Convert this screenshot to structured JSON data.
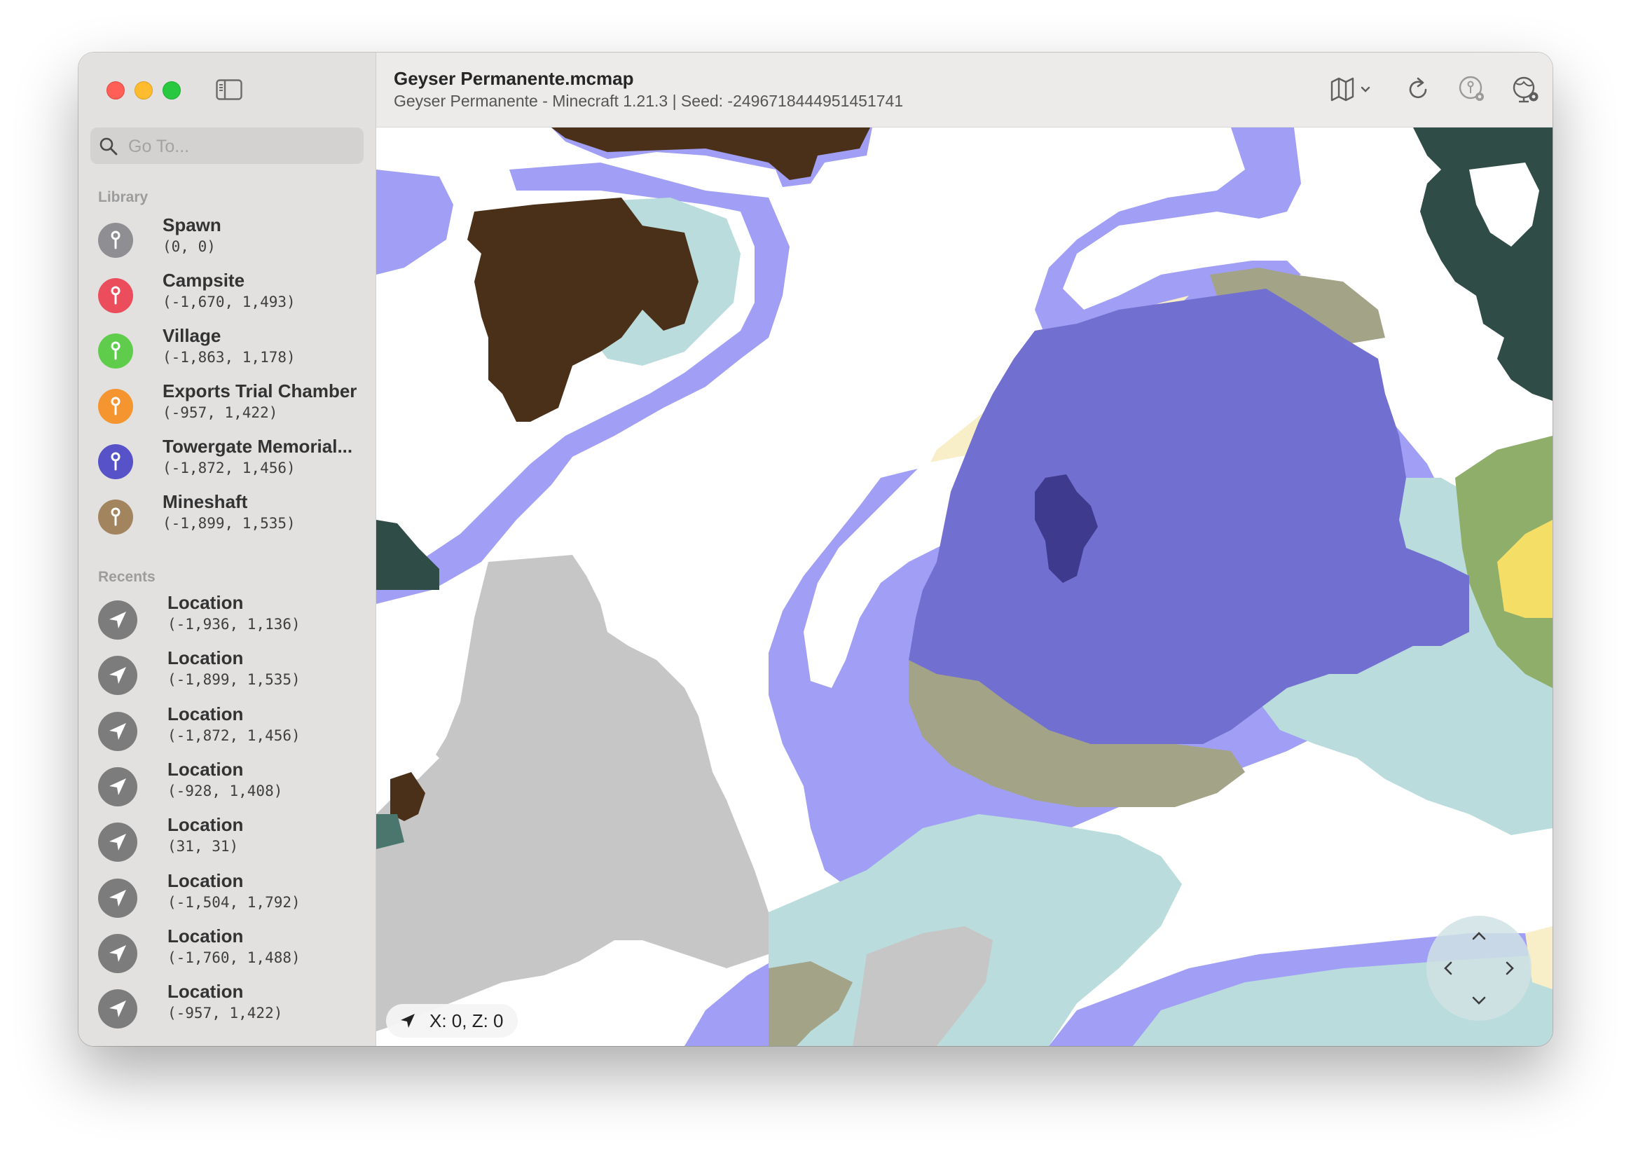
{
  "window": {
    "title": "Geyser Permanente.mcmap",
    "subtitle": "Geyser Permanente - Minecraft 1.21.3 | Seed: -2496718444951451741"
  },
  "sidebar": {
    "search_placeholder": "Go To...",
    "library_title": "Library",
    "library": [
      {
        "name": "Spawn",
        "coords": "(0, 0)",
        "color": "#8e8e93",
        "icon": "map-pin-icon"
      },
      {
        "name": "Campsite",
        "coords": "(-1,670, 1,493)",
        "color": "#eb4d5c",
        "icon": "map-pin-icon"
      },
      {
        "name": "Village",
        "coords": "(-1,863, 1,178)",
        "color": "#5fcd4b",
        "icon": "map-pin-icon"
      },
      {
        "name": "Exports Trial Chamber",
        "coords": "(-957, 1,422)",
        "color": "#f4952f",
        "icon": "map-pin-icon"
      },
      {
        "name": "Towergate Memorial...",
        "coords": "(-1,872, 1,456)",
        "color": "#5752c8",
        "icon": "map-pin-icon"
      },
      {
        "name": "Mineshaft",
        "coords": "(-1,899, 1,535)",
        "color": "#a2845e",
        "icon": "map-pin-icon"
      }
    ],
    "recents_title": "Recents",
    "recents": [
      {
        "name": "Location",
        "coords": "(-1,936, 1,136)"
      },
      {
        "name": "Location",
        "coords": "(-1,899, 1,535)"
      },
      {
        "name": "Location",
        "coords": "(-1,872, 1,456)"
      },
      {
        "name": "Location",
        "coords": "(-928, 1,408)"
      },
      {
        "name": "Location",
        "coords": "(31, 31)"
      },
      {
        "name": "Location",
        "coords": "(-1,504, 1,792)"
      },
      {
        "name": "Location",
        "coords": "(-1,760, 1,488)"
      },
      {
        "name": "Location",
        "coords": "(-957, 1,422)"
      }
    ]
  },
  "toolbar": {
    "icons": [
      "map-icon",
      "chevron-down-icon",
      "refresh-icon",
      "pin-settings-icon",
      "world-settings-icon"
    ]
  },
  "map": {
    "coord_readout": "X: 0, Z: 0",
    "biome_colors": {
      "background": "#ffffff",
      "river": "#a09ff5",
      "ocean": "#716fcf",
      "deep_ocean": "#3e3b8e",
      "frozen": "#badcdc",
      "dark_forest": "#2f4d46",
      "brown": "#4a3019",
      "mountain": "#c6c6c6",
      "beach": "#f8efc8",
      "swamp": "#a3a388",
      "plains": "#8eae6a",
      "desert": "#f5de66"
    }
  }
}
